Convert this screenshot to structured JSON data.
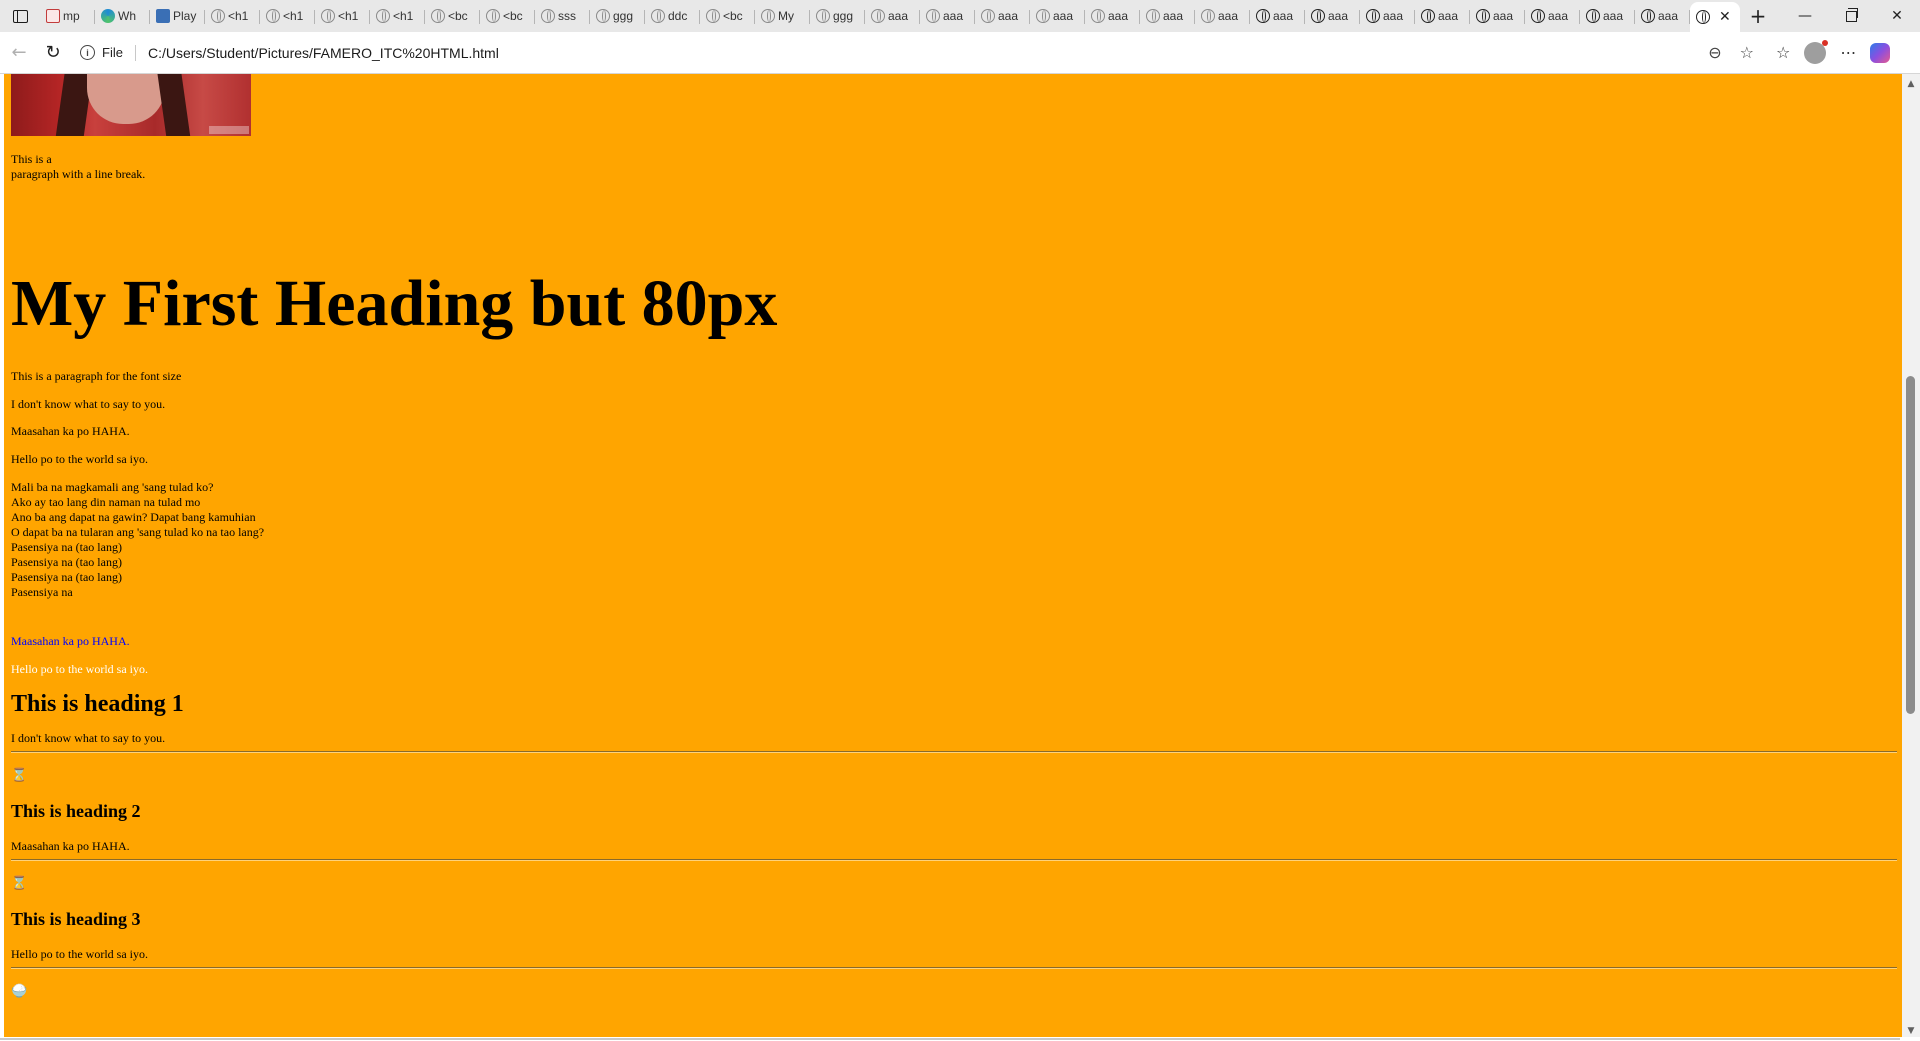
{
  "browser": {
    "tabs": [
      {
        "icon": "pdf-icon",
        "title": "mp"
      },
      {
        "icon": "edge-icon",
        "title": "Wh"
      },
      {
        "icon": "play-icon",
        "title": "Play"
      },
      {
        "icon": "globe-icon",
        "title": "<h1"
      },
      {
        "icon": "globe-icon",
        "title": "<h1"
      },
      {
        "icon": "globe-icon",
        "title": "<h1"
      },
      {
        "icon": "globe-icon",
        "title": "<h1"
      },
      {
        "icon": "globe-icon",
        "title": "<bc"
      },
      {
        "icon": "globe-icon",
        "title": "<bc"
      },
      {
        "icon": "globe-icon",
        "title": "sss"
      },
      {
        "icon": "globe-icon",
        "title": "ggg"
      },
      {
        "icon": "globe-icon",
        "title": "ddc"
      },
      {
        "icon": "globe-icon",
        "title": "<bc"
      },
      {
        "icon": "globe-icon",
        "title": "My"
      },
      {
        "icon": "globe-icon",
        "title": "ggg"
      },
      {
        "icon": "globe-icon",
        "title": "aaa"
      },
      {
        "icon": "globe-icon",
        "title": "aaa"
      },
      {
        "icon": "globe-icon",
        "title": "aaa"
      },
      {
        "icon": "globe-icon",
        "title": "aaa"
      },
      {
        "icon": "globe-icon",
        "title": "aaa"
      },
      {
        "icon": "globe-icon",
        "title": "aaa"
      },
      {
        "icon": "globe-icon",
        "title": "aaa"
      },
      {
        "icon": "globe-icon",
        "title": "aaa"
      },
      {
        "icon": "globe-icon",
        "title": "aaa"
      },
      {
        "icon": "globe-icon",
        "title": "aaa"
      },
      {
        "icon": "globe-icon",
        "title": "aaa"
      },
      {
        "icon": "globe-icon",
        "title": "aaa"
      },
      {
        "icon": "globe-icon",
        "title": "aaa"
      },
      {
        "icon": "globe-icon",
        "title": "aaa"
      },
      {
        "icon": "globe-icon",
        "title": "aaa"
      }
    ],
    "active_tab_close": "✕",
    "new_tab": "+",
    "window": {
      "minimize": "—",
      "close": "✕"
    },
    "address": {
      "scheme": "File",
      "url": "C:/Users/Student/Pictures/FAMERO_ITC%20HTML.html"
    }
  },
  "page": {
    "background": "#ffa500",
    "image": {
      "alt": "anime-portrait-image"
    },
    "linebreak": {
      "line1": "This is a",
      "line2": "paragraph with a line break."
    },
    "big_heading": "My First Heading but 80px",
    "para_fontsize": "This is a paragraph for the font size",
    "para_1": "I don't know what to say to you.",
    "para_2": "Maasahan ka po HAHA.",
    "para_3": "Hello po to the world sa iyo.",
    "lyrics": [
      "Mali ba na magkamali ang 'sang tulad ko?",
      "Ako ay tao lang din naman na tulad mo",
      "Ano ba ang dapat na gawin? Dapat bang kamuhian",
      "O dapat ba na tularan ang 'sang tulad ko na tao lang?",
      "Pasensiya na (tao lang)",
      "Pasensiya na (tao lang)",
      "Pasensiya na (tao lang)",
      "Pasensiya na"
    ],
    "blue_text": "Maasahan ka po HAHA.",
    "white_text": "Hello po to the world sa iyo.",
    "sections": [
      {
        "heading": "This is heading 1",
        "body": "I don't know what to say to you.",
        "emoji": "⌛"
      },
      {
        "heading": "This is heading 2",
        "body": "Maasahan ka po HAHA.",
        "emoji": "⌛"
      },
      {
        "heading": "This is heading 3",
        "body": "Hello po to the world sa iyo.",
        "emoji": "🍚"
      }
    ]
  }
}
